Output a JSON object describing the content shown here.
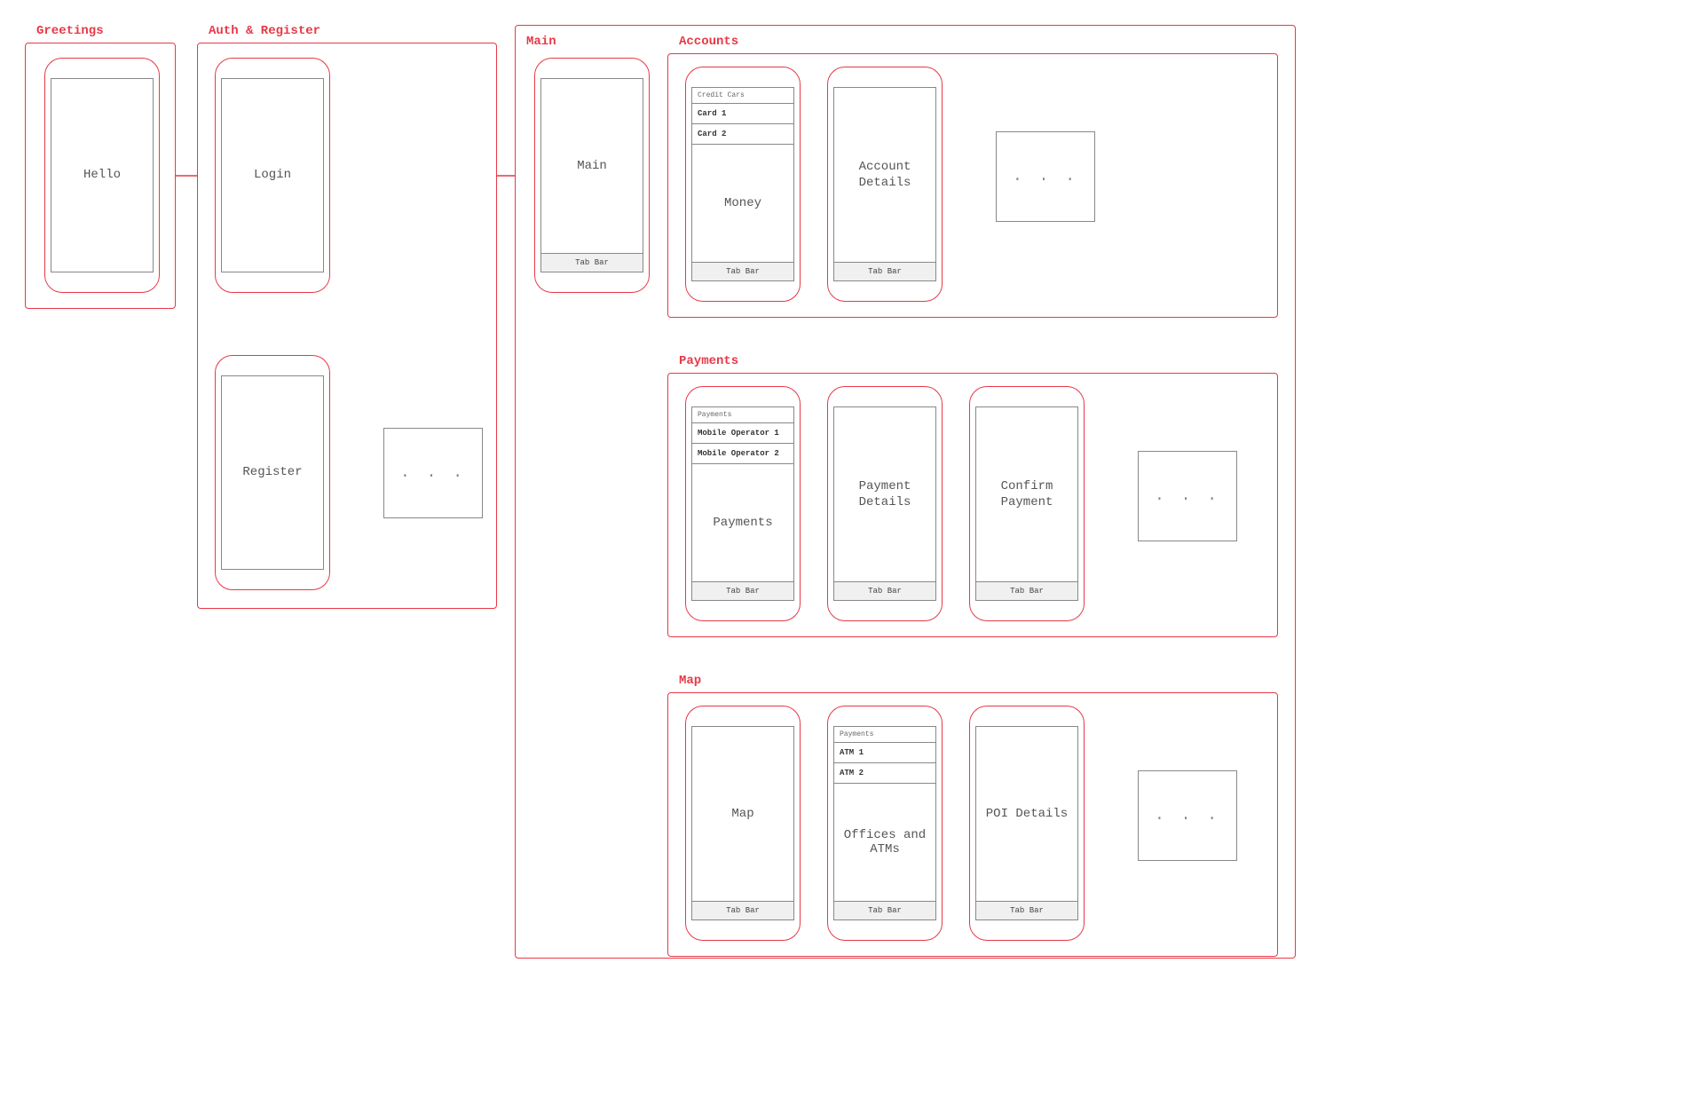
{
  "groups": {
    "greetings": {
      "label": "Greetings"
    },
    "auth": {
      "label": "Auth & Register"
    },
    "main": {
      "label": "Main"
    },
    "accounts": {
      "label": "Accounts"
    },
    "payments": {
      "label": "Payments"
    },
    "map": {
      "label": "Map"
    }
  },
  "screens": {
    "hello": {
      "title": "Hello"
    },
    "login": {
      "title": "Login"
    },
    "register": {
      "title": "Register"
    },
    "main": {
      "title": "Main",
      "tabbar": "Tab Bar"
    },
    "money": {
      "title": "Money",
      "tabbar": "Tab Bar",
      "list_header": "Credit Cars",
      "items": [
        "Card 1",
        "Card 2"
      ]
    },
    "account_details": {
      "title": "Account Details",
      "tabbar": "Tab Bar"
    },
    "payments_list": {
      "title": "Payments",
      "tabbar": "Tab Bar",
      "list_header": "Payments",
      "items": [
        "Mobile Operator 1",
        "Mobile Operator 2"
      ]
    },
    "payment_details": {
      "title": "Payment Details",
      "tabbar": "Tab Bar"
    },
    "confirm_payment": {
      "title": "Confirm Payment",
      "tabbar": "Tab Bar"
    },
    "map_screen": {
      "title": "Map",
      "tabbar": "Tab Bar"
    },
    "offices": {
      "title": "Offices and ATMs",
      "tabbar": "Tab Bar",
      "list_header": "Payments",
      "items": [
        "ATM 1",
        "ATM 2"
      ]
    },
    "poi_details": {
      "title": "POI Details",
      "tabbar": "Tab Bar"
    }
  },
  "placeholders": {
    "dots": ". . ."
  }
}
